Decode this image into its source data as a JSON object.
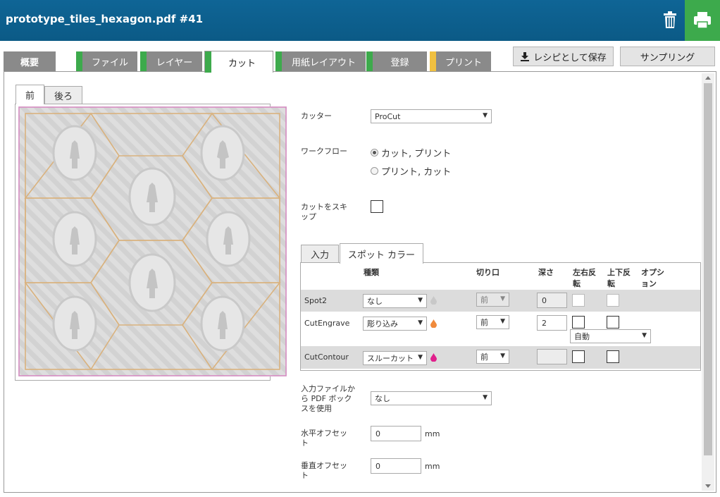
{
  "header": {
    "title": "prototype_tiles_hexagon.pdf #41",
    "trash_icon": "trash-icon",
    "print_icon": "printer-icon",
    "print_color": "#3daa4c",
    "bg_color": "#0b5a86"
  },
  "tabs": [
    {
      "label": "概要",
      "stripe": ""
    },
    {
      "label": "ファイル",
      "stripe": "#3daa4c"
    },
    {
      "label": "レイヤー",
      "stripe": "#3daa4c"
    },
    {
      "label": "カット",
      "stripe": "#3daa4c"
    },
    {
      "label": "用紙レイアウト",
      "stripe": "#3daa4c"
    },
    {
      "label": "登録",
      "stripe": "#3daa4c"
    },
    {
      "label": "プリント",
      "stripe": "#f0c040"
    }
  ],
  "actions": {
    "save_recipe": "レシピとして保存",
    "sampling": "サンプリング"
  },
  "preview": {
    "tab_front": "前",
    "tab_back": "後ろ"
  },
  "form": {
    "cutter_label": "カッター",
    "cutter_value": "ProCut",
    "workflow_label": "ワークフロー",
    "workflow_option1": "カット, プリント",
    "workflow_option2": "プリント, カット",
    "skip_cut_label": "カットをスキップ",
    "pdfbox_label": "入力ファイルから PDF ボックスを使用",
    "pdfbox_value": "なし",
    "h_offset_label": "水平オフセット",
    "h_offset_value": "0",
    "v_offset_label": "垂直オフセット",
    "v_offset_value": "0",
    "unit": "mm"
  },
  "spot": {
    "tab_input": "入力",
    "tab_spot": "スポット カラー",
    "headers": {
      "type": "種類",
      "cut_side": "切り口",
      "depth": "深さ",
      "flip_h": "左右反転",
      "flip_v": "上下反転",
      "options": "オプション"
    },
    "rows": [
      {
        "name": "Spot2",
        "type": "なし",
        "side": "前",
        "depth": "0",
        "drop_color": "#c8c8c8"
      },
      {
        "name": "CutEngrave",
        "type": "彫り込み",
        "side": "前",
        "depth": "2",
        "drop_color": "#f08a3c",
        "option": "自動"
      },
      {
        "name": "CutContour",
        "type": "スルーカット",
        "side": "前",
        "depth": "",
        "drop_color": "#e0208c"
      }
    ]
  }
}
